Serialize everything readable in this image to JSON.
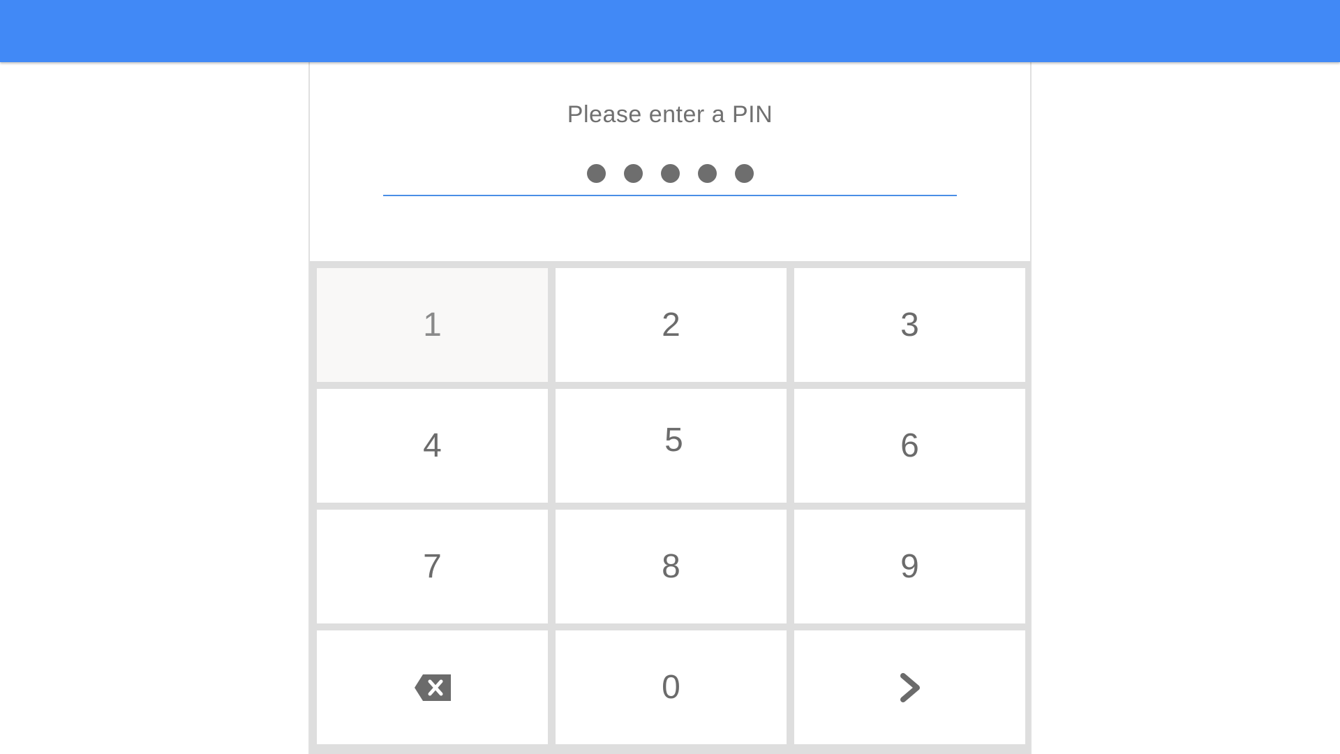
{
  "header": {
    "color": "#4189f6"
  },
  "pin_entry": {
    "prompt": "Please enter a PIN",
    "masked_digit_count": 5,
    "underline_color": "#4a8ee6"
  },
  "keypad": {
    "keys": [
      {
        "label": "1",
        "icon": null,
        "state": "pressed"
      },
      {
        "label": "2",
        "icon": null
      },
      {
        "label": "3",
        "icon": null
      },
      {
        "label": "4",
        "icon": null
      },
      {
        "label": "5",
        "icon": null
      },
      {
        "label": "6",
        "icon": null
      },
      {
        "label": "7",
        "icon": null
      },
      {
        "label": "8",
        "icon": null
      },
      {
        "label": "9",
        "icon": null
      },
      {
        "label": "",
        "icon": "backspace-icon"
      },
      {
        "label": "0",
        "icon": null
      },
      {
        "label": "",
        "icon": "chevron-right-icon"
      }
    ]
  }
}
